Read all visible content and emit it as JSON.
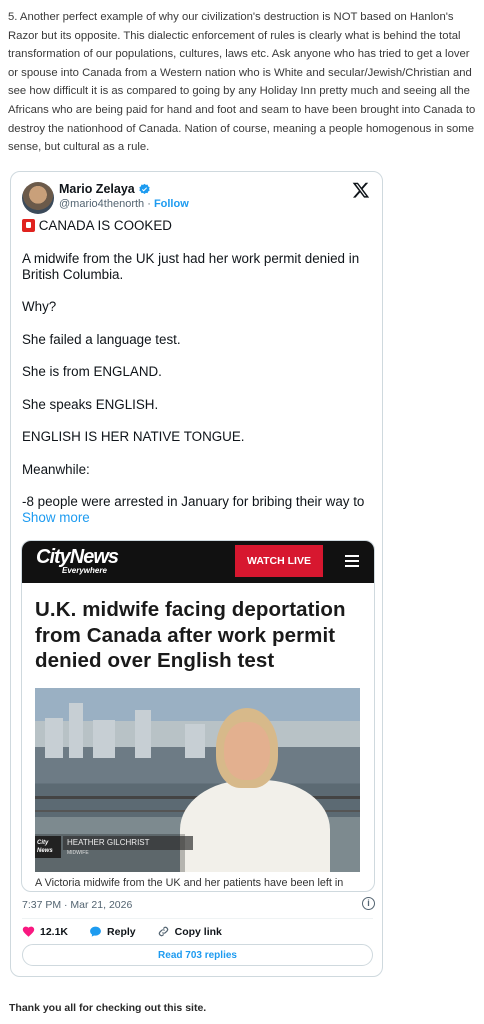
{
  "intro_text": "5. Another perfect example of why our civilization's destruction is NOT based on Hanlon's Razor but its opposite. This dialectic enforcement of rules is clearly what is behind the total transformation of our populations, cultures, laws etc. Ask anyone who has tried to get a lover or spouse into Canada from a Western nation who is White and secular/Jewish/Christian and see how difficult it is as compared to going by any Holiday Inn pretty much and seeing all the Africans who are being paid for hand and foot and seam to have been brought into Canada to destroy the nationhood of Canada. Nation of course, meaning a people homogenous in some sense, but cultural as a rule.",
  "tweet": {
    "author_name": "Mario Zelaya",
    "handle": "@mario4thenorth",
    "separator": " · ",
    "follow_label": "Follow",
    "paragraphs": [
      "CANADA IS COOKED",
      "A midwife from the UK just had her work permit denied in British Columbia.",
      "Why?",
      "She failed a language test.",
      "She is from ENGLAND.",
      "She speaks ENGLISH.",
      "ENGLISH IS HER NATIVE TONGUE.",
      "Meanwhile:",
      "-8 people were arrested in January for bribing their way to"
    ],
    "show_more": "Show more",
    "timestamp": "7:37 PM · Mar 21, 2026",
    "likes": "12.1K",
    "reply_label": "Reply",
    "copy_label": "Copy link",
    "read_replies": "Read 703 replies"
  },
  "card": {
    "brand": "CityNews",
    "brand_sub": "Everywhere",
    "watch_live": "WATCH LIVE",
    "headline": "U.K. midwife facing deportation from Canada after work permit denied over English test",
    "lower_third_brand": "City News",
    "lower_third_name": "HEATHER GILCHRIST",
    "lower_third_role": "MIDWIFE",
    "caption": "A Victoria midwife from the UK and her patients have been left in"
  },
  "footer_text": "Thank you all for checking out this site.",
  "colors": {
    "link": "#1d9bf0",
    "heart": "#f91880",
    "watch_live_bg": "#d7172f"
  }
}
